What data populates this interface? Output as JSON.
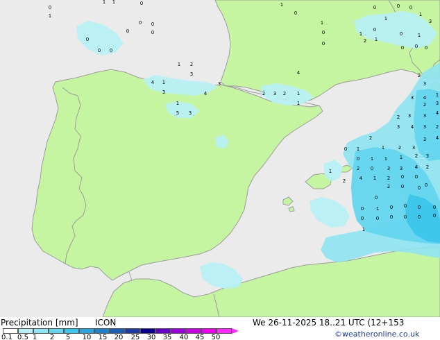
{
  "title": {
    "label": "Precipitation [mm]",
    "model": "ICON"
  },
  "validity": {
    "date": "We 26-11-2025 18..21 UTC (12+153"
  },
  "credit": "©weatheronline.co.uk",
  "colorbar": {
    "labels": [
      "0.1",
      "0.5",
      "1",
      "2",
      "5",
      "10",
      "15",
      "20",
      "25",
      "30",
      "35",
      "40",
      "45",
      "50"
    ],
    "colors": [
      "#ffffff",
      "#b8f0f6",
      "#8ee4f2",
      "#63d6ee",
      "#3cc5ea",
      "#2aa4dc",
      "#2080c8",
      "#1c5cb4",
      "#1a3aa0",
      "#0a008c",
      "#6600c8",
      "#9a00d8",
      "#cc00e4",
      "#ee00ee",
      "#ff28ff"
    ]
  },
  "map_colors": {
    "sea": "#ebebeb",
    "land": "#c5f5a0",
    "border": "#9c9c9c"
  },
  "cell_values": [
    "0",
    "1",
    "1",
    "1",
    "0",
    "0",
    "0",
    "0",
    "0",
    "0",
    "0",
    "0",
    "1",
    "0",
    "1",
    "0",
    "0",
    "0",
    "0",
    "0",
    "1",
    "0",
    "1",
    "2",
    "1",
    "0",
    "0",
    "0",
    "0",
    "1",
    "3",
    "1",
    "1",
    "2",
    "3",
    "4",
    "1",
    "3",
    "1",
    "5",
    "3",
    "4",
    "3",
    "4",
    "2",
    "3",
    "2",
    "1",
    "1",
    "2",
    "3",
    "3",
    "4",
    "1",
    "2",
    "3",
    "3",
    "3",
    "4",
    "2",
    "3",
    "4",
    "3",
    "2",
    "0",
    "1",
    "2",
    "1",
    "2",
    "3",
    "3",
    "4",
    "0",
    "1",
    "1",
    "1",
    "2",
    "3",
    "2",
    "0",
    "3",
    "3",
    "4",
    "2",
    "4",
    "1",
    "2",
    "0",
    "0",
    "0",
    "1",
    "2",
    "2",
    "0",
    "0",
    "0",
    "0",
    "1",
    "0",
    "0",
    "0",
    "0",
    "0",
    "0",
    "0",
    "0",
    "0",
    "0",
    "1"
  ]
}
